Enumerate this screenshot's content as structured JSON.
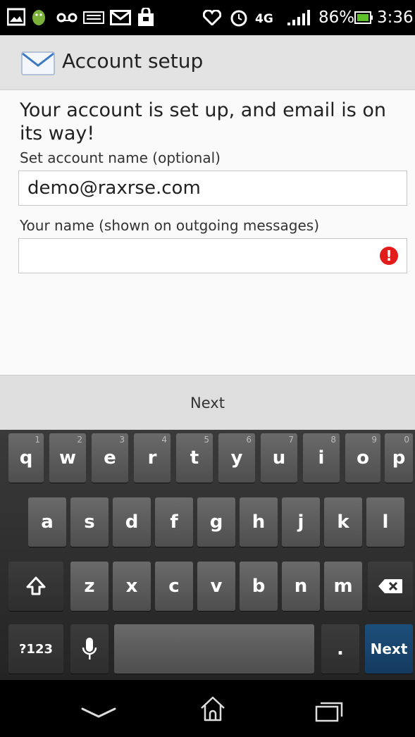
{
  "status_bar": {
    "icons": [
      "picture-icon",
      "android-icon",
      "voicemail-icon",
      "keyboard-icon",
      "mail-icon",
      "shopping-bag-icon",
      "heart-icon",
      "alarm-icon",
      "4g-lte-icon",
      "signal-icon",
      "battery-icon"
    ],
    "network": "4G",
    "battery_percent": "86%",
    "time": "3:36"
  },
  "action_bar": {
    "icon": "mail-icon",
    "title": "Account setup"
  },
  "content": {
    "headline": "Your account is set up, and email is on its way!",
    "account_name_label": "Set account name (optional)",
    "account_name_value": "demo@raxrse.com",
    "your_name_label": "Your name (shown on outgoing messages)",
    "your_name_value": "",
    "your_name_error_icon": "error-icon",
    "error_glyph": "!"
  },
  "next_button": {
    "label": "Next"
  },
  "keyboard": {
    "row1": [
      {
        "key": "q",
        "hint": "1"
      },
      {
        "key": "w",
        "hint": "2"
      },
      {
        "key": "e",
        "hint": "3"
      },
      {
        "key": "r",
        "hint": "4"
      },
      {
        "key": "t",
        "hint": "5"
      },
      {
        "key": "y",
        "hint": "6"
      },
      {
        "key": "u",
        "hint": "7"
      },
      {
        "key": "i",
        "hint": "8"
      },
      {
        "key": "o",
        "hint": "9"
      },
      {
        "key": "p",
        "hint": "0"
      }
    ],
    "row2": [
      "a",
      "s",
      "d",
      "f",
      "g",
      "h",
      "j",
      "k",
      "l"
    ],
    "row3": [
      "z",
      "x",
      "c",
      "v",
      "b",
      "n",
      "m"
    ],
    "shift_icon": "shift-icon",
    "backspace_icon": "backspace-icon",
    "symbols_key": "?123",
    "mic_icon": "microphone-icon",
    "period_key": ".",
    "next_key": "Next"
  },
  "nav_bar": {
    "icons": [
      "back-icon",
      "home-icon",
      "recent-apps-icon"
    ]
  }
}
